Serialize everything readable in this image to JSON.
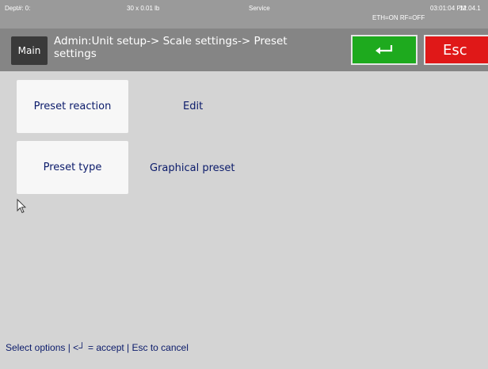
{
  "status": {
    "dept": "Dept#: 0:",
    "weight": "30 x 0.01 lb",
    "mode": "Service",
    "time": "03:01:04 PM",
    "date": "12.04.1",
    "network": "ETH=ON RF=OFF"
  },
  "header": {
    "main_label": "Main",
    "breadcrumb": "Admin:Unit setup-> Scale settings-> Preset settings",
    "esc_label": "Esc",
    "accept_icon": "enter-return-icon",
    "accept_color": "#1eaa1e",
    "esc_color": "#e01818"
  },
  "settings": [
    {
      "label": "Preset reaction",
      "value": "Edit"
    },
    {
      "label": "Preset type",
      "value": "Graphical preset"
    }
  ],
  "footer": {
    "hint": "Select options | <┘ = accept | Esc to cancel"
  }
}
